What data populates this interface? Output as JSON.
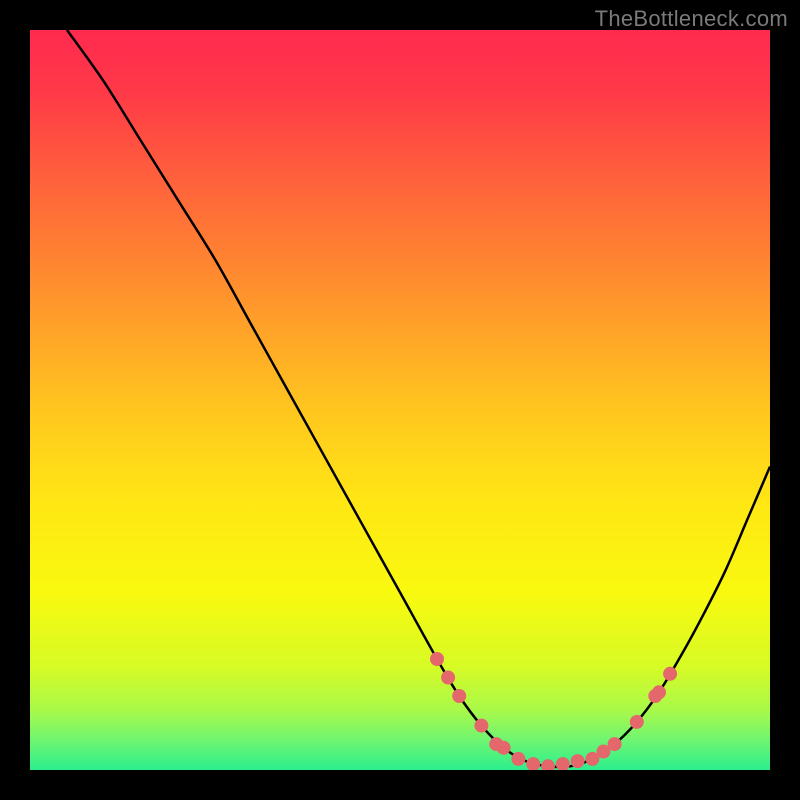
{
  "watermark": "TheBottleneck.com",
  "chart_data": {
    "type": "line",
    "title": "",
    "xlabel": "",
    "ylabel": "",
    "xlim": [
      0,
      100
    ],
    "ylim": [
      0,
      100
    ],
    "grid": false,
    "legend": false,
    "series": [
      {
        "name": "curve",
        "color": "#000000",
        "x": [
          5,
          10,
          15,
          20,
          25,
          30,
          35,
          40,
          45,
          50,
          55,
          58,
          61,
          64,
          67,
          70,
          73,
          76,
          79,
          82,
          85,
          88,
          91,
          94,
          97,
          100
        ],
        "values": [
          100,
          93,
          85,
          77,
          69,
          60,
          51,
          42,
          33,
          24,
          15,
          10,
          6,
          3,
          1.2,
          0.5,
          0.5,
          1.5,
          3.5,
          6.5,
          10.5,
          15.5,
          21,
          27,
          34,
          41
        ]
      }
    ],
    "markers": {
      "name": "beads",
      "color": "#e4686b",
      "radius": 7,
      "points": [
        {
          "x": 55,
          "y": 15
        },
        {
          "x": 56.5,
          "y": 12.5
        },
        {
          "x": 58,
          "y": 10
        },
        {
          "x": 61,
          "y": 6
        },
        {
          "x": 63,
          "y": 3.5
        },
        {
          "x": 64,
          "y": 3
        },
        {
          "x": 66,
          "y": 1.5
        },
        {
          "x": 68,
          "y": 0.8
        },
        {
          "x": 70,
          "y": 0.5
        },
        {
          "x": 72,
          "y": 0.8
        },
        {
          "x": 74,
          "y": 1.2
        },
        {
          "x": 76,
          "y": 1.5
        },
        {
          "x": 77.5,
          "y": 2.5
        },
        {
          "x": 79,
          "y": 3.5
        },
        {
          "x": 82,
          "y": 6.5
        },
        {
          "x": 84.5,
          "y": 10
        },
        {
          "x": 85,
          "y": 10.5
        },
        {
          "x": 86.5,
          "y": 13
        }
      ]
    },
    "gradient_stops": [
      {
        "offset": 0.0,
        "color": "#ff2a4f"
      },
      {
        "offset": 0.08,
        "color": "#ff3848"
      },
      {
        "offset": 0.18,
        "color": "#ff5a3e"
      },
      {
        "offset": 0.28,
        "color": "#ff7a34"
      },
      {
        "offset": 0.4,
        "color": "#ffa129"
      },
      {
        "offset": 0.52,
        "color": "#ffc81e"
      },
      {
        "offset": 0.64,
        "color": "#ffe714"
      },
      {
        "offset": 0.76,
        "color": "#f9f90f"
      },
      {
        "offset": 0.86,
        "color": "#d7fb25"
      },
      {
        "offset": 0.92,
        "color": "#a8f94a"
      },
      {
        "offset": 0.96,
        "color": "#6ef571"
      },
      {
        "offset": 1.0,
        "color": "#2bef8e"
      }
    ]
  }
}
